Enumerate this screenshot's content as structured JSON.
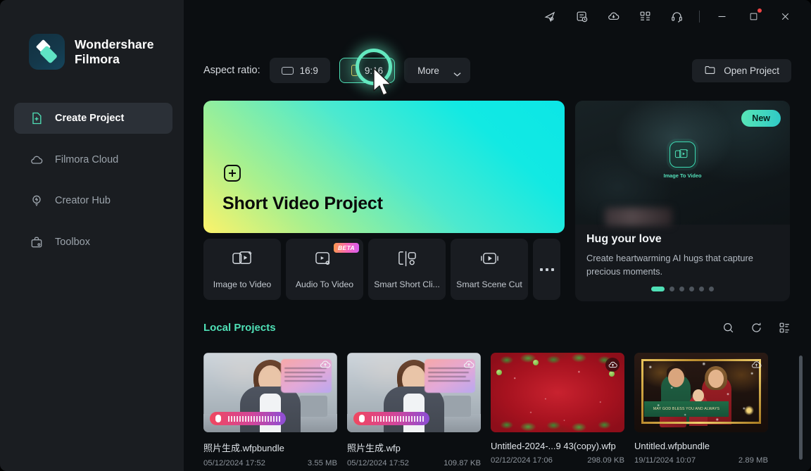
{
  "app": {
    "brand_line1": "Wondershare",
    "brand_line2": "Filmora"
  },
  "sidebar": {
    "items": [
      {
        "label": "Create Project",
        "icon": "document-plus-icon",
        "active": true
      },
      {
        "label": "Filmora Cloud",
        "icon": "cloud-icon",
        "active": false
      },
      {
        "label": "Creator Hub",
        "icon": "lightbulb-icon",
        "active": false
      },
      {
        "label": "Toolbox",
        "icon": "toolbox-icon",
        "active": false
      }
    ]
  },
  "titlebar": {
    "buttons": [
      {
        "name": "send-feedback-icon"
      },
      {
        "name": "task-list-icon"
      },
      {
        "name": "cloud-download-icon"
      },
      {
        "name": "apps-grid-icon"
      },
      {
        "name": "headset-support-icon"
      }
    ],
    "minimize": "minimize-icon",
    "maximize": "maximize-icon",
    "close": "close-icon",
    "has_notification_dot": true
  },
  "aspect": {
    "label": "Aspect ratio:",
    "options": [
      {
        "value": "16:9",
        "selected": false
      },
      {
        "value": "9:16",
        "selected": true
      }
    ],
    "more_label": "More"
  },
  "open_project": {
    "label": "Open Project",
    "icon": "folder-icon"
  },
  "hero": {
    "title": "Short Video Project",
    "icon": "plus-square-icon"
  },
  "tools": [
    {
      "label": "Image to Video",
      "icon": "image-to-video-icon",
      "badge": null
    },
    {
      "label": "Audio To Video",
      "icon": "audio-to-video-icon",
      "badge": "BETA"
    },
    {
      "label": "Smart Short Cli...",
      "icon": "smart-short-clip-icon",
      "badge": null
    },
    {
      "label": "Smart Scene Cut",
      "icon": "smart-scene-cut-icon",
      "badge": null
    }
  ],
  "tools_more": "...",
  "promo": {
    "badge": "New",
    "icon_label": "Image To Video",
    "title": "Hug your love",
    "description": "Create heartwarming AI hugs that capture precious moments.",
    "dots_total": 6,
    "dots_active_index": 0
  },
  "local_projects": {
    "title": "Local Projects",
    "actions": [
      {
        "name": "search-icon"
      },
      {
        "name": "refresh-icon"
      },
      {
        "name": "list-view-icon"
      }
    ],
    "items": [
      {
        "name": "照片生成.wfpbundle",
        "date": "05/12/2024 17:52",
        "size": "3.55 MB",
        "thumb": "office-portrait",
        "cloud": "cloud-upload-icon"
      },
      {
        "name": "照片生成.wfp",
        "date": "05/12/2024 17:52",
        "size": "109.87 KB",
        "thumb": "office-portrait",
        "cloud": "cloud-upload-icon"
      },
      {
        "name": "Untitled-2024-...9 43(copy).wfp",
        "date": "02/12/2024 17:06",
        "size": "298.09 KB",
        "thumb": "christmas-red",
        "cloud": "cloud-upload-icon"
      },
      {
        "name": "Untitled.wfpbundle",
        "date": "19/11/2024 10:07",
        "size": "2.89 MB",
        "thumb": "family-photo",
        "cloud": "cloud-upload-icon",
        "ribbon_text": "MAY GOD BLESS YOU  AND ALWAYS"
      }
    ]
  },
  "colors": {
    "accent": "#4fe0b6",
    "sidebar_bg": "#1a1d21",
    "main_bg": "#0b0e11",
    "card_bg": "#191c21",
    "notification_dot": "#ef4444"
  }
}
